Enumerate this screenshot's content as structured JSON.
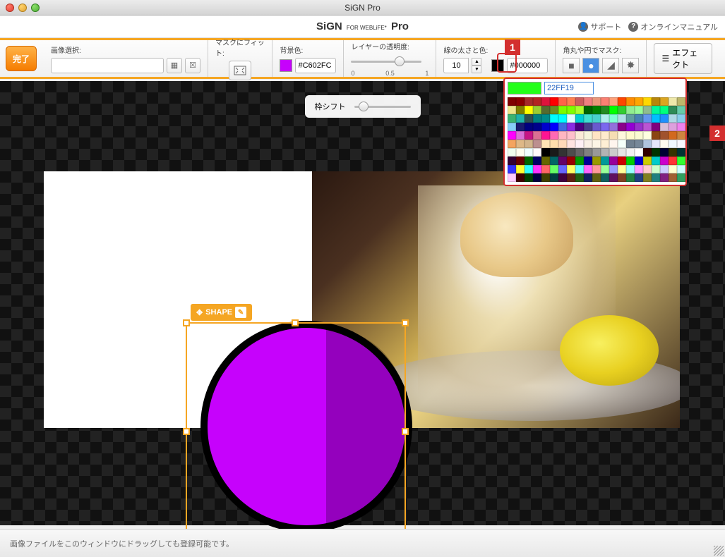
{
  "window": {
    "title": "SiGN Pro"
  },
  "brand": {
    "main": "SiGN",
    "sub": "FOR WEBLiFE*",
    "pro": "Pro"
  },
  "header": {
    "support": "サポート",
    "manual": "オンラインマニュアル"
  },
  "toolbar": {
    "done": "完了",
    "image_select": "画像選択:",
    "mask_fit": "マスクにフィット:",
    "bg_color": "背景色:",
    "bg_hex": "#C602FC",
    "opacity": "レイヤーの透明度:",
    "opacity_min": "0",
    "opacity_mid": "0.5",
    "opacity_max": "1",
    "line": "線の太さと色:",
    "line_width": "10",
    "line_hex": "#000000",
    "mask_shape": "角丸や円でマスク:",
    "effect": "エフェクト"
  },
  "sub_toolbar": {
    "frame_shift": "枠シフト"
  },
  "shape_badge": {
    "label": "SHAPE"
  },
  "color_popup": {
    "preview": "#22FF19",
    "hex": "22FF19",
    "colors": [
      "#800000",
      "#8b0000",
      "#a52a2a",
      "#b22222",
      "#dc143c",
      "#ff0000",
      "#ff6347",
      "#ff7f50",
      "#cd5c5c",
      "#f08080",
      "#e9967a",
      "#fa8072",
      "#ffa07a",
      "#ff4500",
      "#ff8c00",
      "#ffa500",
      "#ffd700",
      "#b8860b",
      "#daa520",
      "#eee8aa",
      "#bdb76b",
      "#f0e68c",
      "#808000",
      "#ffff00",
      "#9acd32",
      "#556b2f",
      "#6b8e23",
      "#7cfc00",
      "#7fff00",
      "#adff2f",
      "#006400",
      "#008000",
      "#228b22",
      "#00ff00",
      "#32cd32",
      "#90ee90",
      "#98fb98",
      "#8fbc8f",
      "#00fa9a",
      "#00ff7f",
      "#2e8b57",
      "#66cdaa",
      "#3cb371",
      "#20b2aa",
      "#2f4f4f",
      "#008080",
      "#008b8b",
      "#00ffff",
      "#00ffff",
      "#e0ffff",
      "#00ced1",
      "#40e0d0",
      "#48d1cc",
      "#afeeee",
      "#7fffd4",
      "#b0e0e6",
      "#5f9ea0",
      "#4682b4",
      "#6495ed",
      "#00bfff",
      "#1e90ff",
      "#add8e6",
      "#87ceeb",
      "#87cefa",
      "#191970",
      "#000080",
      "#00008b",
      "#0000cd",
      "#0000ff",
      "#4169e1",
      "#8a2be2",
      "#4b0082",
      "#483d8b",
      "#6a5acd",
      "#7b68ee",
      "#9370db",
      "#8b008b",
      "#9400d3",
      "#9932cc",
      "#ba55d3",
      "#800080",
      "#d8bfd8",
      "#dda0dd",
      "#ee82ee",
      "#ff00ff",
      "#da70d6",
      "#c71585",
      "#db7093",
      "#ff1493",
      "#ff69b4",
      "#ffb6c1",
      "#ffc0cb",
      "#faebd7",
      "#f5f5dc",
      "#ffe4c4",
      "#ffebcd",
      "#f5deb3",
      "#fff8dc",
      "#fffacd",
      "#fafad2",
      "#ffffe0",
      "#8b4513",
      "#a0522d",
      "#d2691e",
      "#cd853f",
      "#f4a460",
      "#deb887",
      "#d2b48c",
      "#bc8f8f",
      "#ffe4b5",
      "#ffdead",
      "#ffdab9",
      "#ffe4e1",
      "#fff0f5",
      "#faf0e6",
      "#fdf5e6",
      "#ffefd5",
      "#fff5ee",
      "#f5fffa",
      "#708090",
      "#778899",
      "#b0c4de",
      "#e6e6fa",
      "#fffaf0",
      "#f0f8ff",
      "#f8f8ff",
      "#f0fff0",
      "#fffff0",
      "#f0ffff",
      "#fffafa",
      "#000000",
      "#1a1a1a",
      "#333333",
      "#4d4d4d",
      "#666666",
      "#808080",
      "#999999",
      "#b3b3b3",
      "#cccccc",
      "#e6e6e6",
      "#f2f2f2",
      "#ffffff",
      "#330000",
      "#003300",
      "#000033",
      "#333300",
      "#003333",
      "#330033",
      "#660000",
      "#006600",
      "#000066",
      "#666600",
      "#006666",
      "#660066",
      "#990000",
      "#009900",
      "#000099",
      "#999900",
      "#009999",
      "#990099",
      "#cc0000",
      "#00cc00",
      "#0000cc",
      "#cccc00",
      "#00cccc",
      "#cc00cc",
      "#ff3333",
      "#33ff33",
      "#3333ff",
      "#ffff33",
      "#33ffff",
      "#ff33ff",
      "#ff6666",
      "#66ff66",
      "#6666ff",
      "#ffff66",
      "#66ffff",
      "#ff66ff",
      "#ff9999",
      "#99ff99",
      "#9999ff",
      "#ffff99",
      "#99ffff",
      "#ff99ff",
      "#ffcccc",
      "#ccffcc",
      "#ccccff",
      "#ffffcc",
      "#ccffff",
      "#ffccff",
      "#400000",
      "#004000",
      "#000040",
      "#404000",
      "#004040",
      "#400040",
      "#602010",
      "#206010",
      "#102060",
      "#606010",
      "#106060",
      "#601060",
      "#804020",
      "#208040",
      "#204080",
      "#808020",
      "#208080",
      "#802080",
      "#a06030",
      "#30a060"
    ]
  },
  "callouts": {
    "one": "1",
    "two": "2"
  },
  "footer": {
    "hint": "画像ファイルをこのウィンドウにドラッグしても登録可能です。"
  }
}
